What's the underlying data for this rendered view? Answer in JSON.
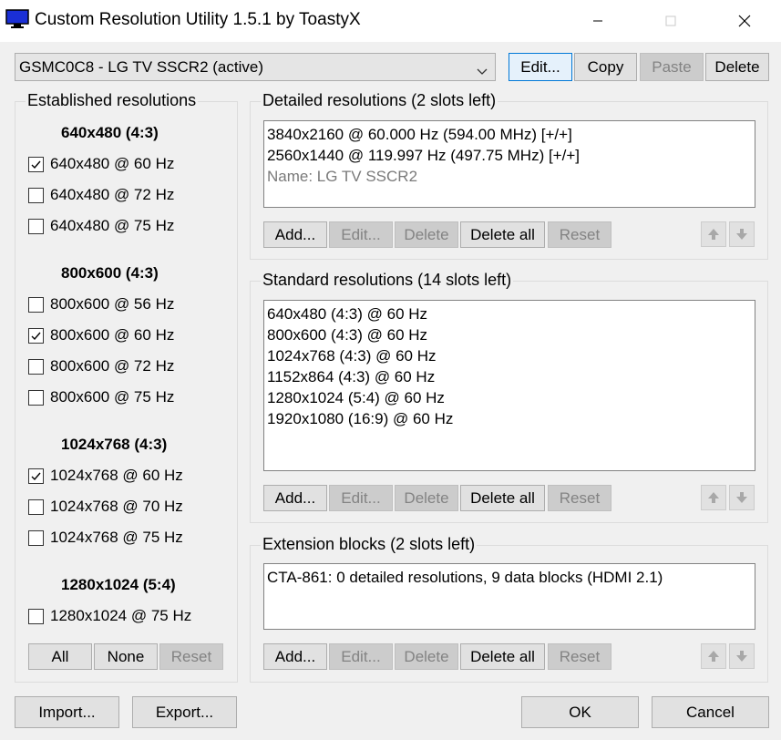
{
  "window": {
    "title": "Custom Resolution Utility 1.5.1 by ToastyX",
    "icon": "monitor-icon",
    "controls": [
      "minimize",
      "maximize",
      "close"
    ]
  },
  "display_select": {
    "value": "GSMC0C8 - LG TV SSCR2 (active)",
    "buttons": {
      "edit": "Edit...",
      "copy": "Copy",
      "paste": "Paste",
      "delete": "Delete"
    }
  },
  "established": {
    "title": "Established resolutions",
    "groups": [
      {
        "heading": "640x480 (4:3)",
        "items": [
          {
            "label": "640x480 @ 60 Hz",
            "checked": true
          },
          {
            "label": "640x480 @ 72 Hz",
            "checked": false
          },
          {
            "label": "640x480 @ 75 Hz",
            "checked": false
          }
        ]
      },
      {
        "heading": "800x600 (4:3)",
        "items": [
          {
            "label": "800x600 @ 56 Hz",
            "checked": false
          },
          {
            "label": "800x600 @ 60 Hz",
            "checked": true
          },
          {
            "label": "800x600 @ 72 Hz",
            "checked": false
          },
          {
            "label": "800x600 @ 75 Hz",
            "checked": false
          }
        ]
      },
      {
        "heading": "1024x768 (4:3)",
        "items": [
          {
            "label": "1024x768 @ 60 Hz",
            "checked": true
          },
          {
            "label": "1024x768 @ 70 Hz",
            "checked": false
          },
          {
            "label": "1024x768 @ 75 Hz",
            "checked": false
          }
        ]
      },
      {
        "heading": "1280x1024 (5:4)",
        "items": [
          {
            "label": "1280x1024 @ 75 Hz",
            "checked": false
          }
        ]
      }
    ],
    "buttons": {
      "all": "All",
      "none": "None",
      "reset": "Reset"
    }
  },
  "detailed": {
    "title": "Detailed resolutions (2 slots left)",
    "lines": [
      "3840x2160 @ 60.000 Hz (594.00 MHz) [+/+]",
      "2560x1440 @ 119.997 Hz (497.75 MHz) [+/+]"
    ],
    "name_line": "Name: LG TV SSCR2"
  },
  "standard": {
    "title": "Standard resolutions (14 slots left)",
    "lines": [
      "640x480 (4:3) @ 60 Hz",
      "800x600 (4:3) @ 60 Hz",
      "1024x768 (4:3) @ 60 Hz",
      "1152x864 (4:3) @ 60 Hz",
      "1280x1024 (5:4) @ 60 Hz",
      "1920x1080 (16:9) @ 60 Hz"
    ]
  },
  "extension": {
    "title": "Extension blocks (2 slots left)",
    "lines": [
      "CTA-861: 0 detailed resolutions, 9 data blocks (HDMI 2.1)"
    ]
  },
  "list_buttons": {
    "add": "Add...",
    "edit": "Edit...",
    "delete": "Delete",
    "delete_all": "Delete all",
    "reset": "Reset"
  },
  "footer": {
    "import": "Import...",
    "export": "Export...",
    "ok": "OK",
    "cancel": "Cancel"
  },
  "colors": {
    "accent": "#0078d7",
    "app_icon": "#1a2fd6",
    "disabled_text": "#838383"
  }
}
